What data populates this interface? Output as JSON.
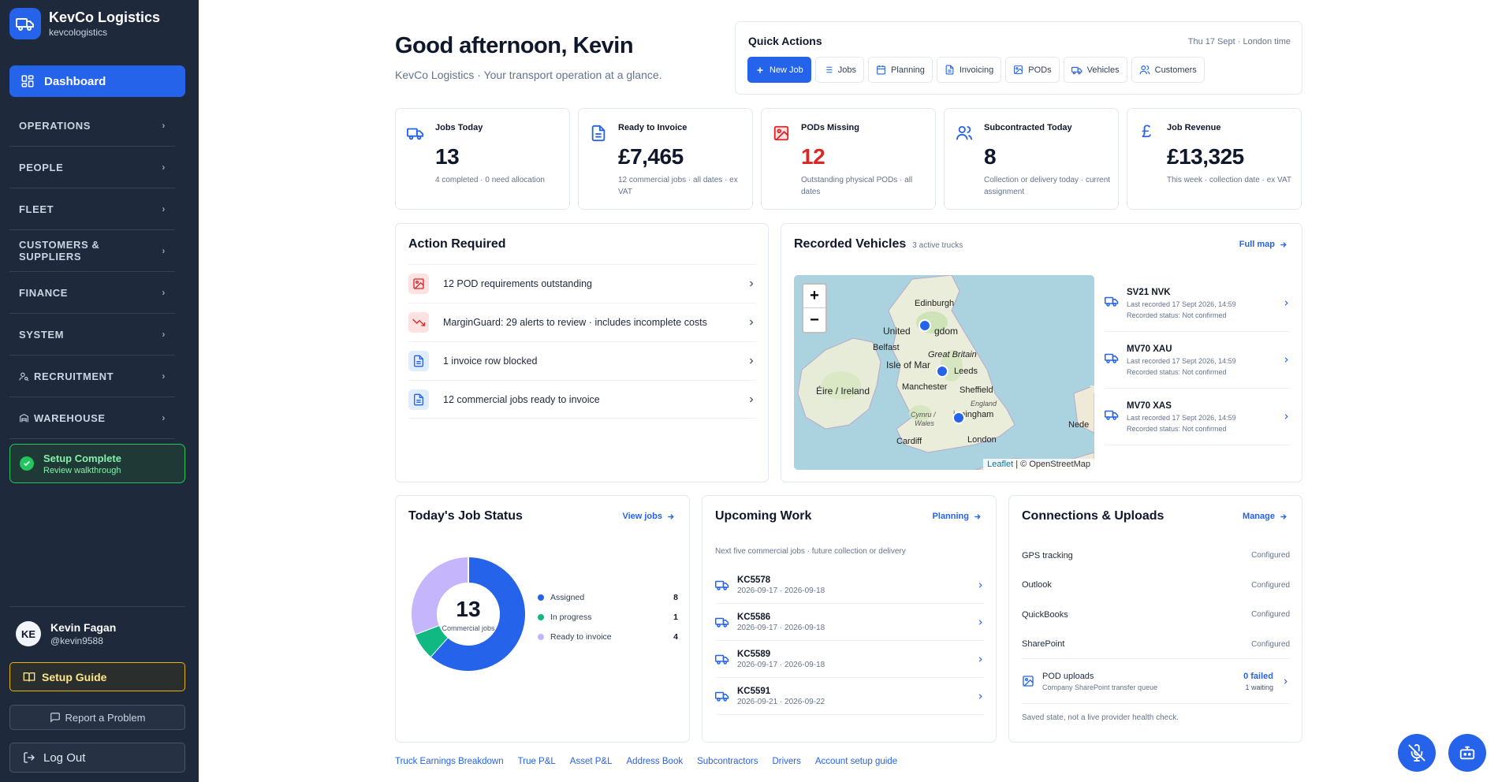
{
  "brand": {
    "name": "KevCo Logistics",
    "sub": "kevcologistics"
  },
  "sidebar": {
    "dashboard": "Dashboard",
    "items": [
      {
        "label": "OPERATIONS",
        "icon": ""
      },
      {
        "label": "PEOPLE",
        "icon": ""
      },
      {
        "label": "FLEET",
        "icon": ""
      },
      {
        "label": "CUSTOMERS & SUPPLIERS",
        "icon": ""
      },
      {
        "label": "FINANCE",
        "icon": ""
      },
      {
        "label": "SYSTEM",
        "icon": ""
      },
      {
        "label": "RECRUITMENT",
        "icon": "user-search-icon"
      },
      {
        "label": "WAREHOUSE",
        "icon": "warehouse-icon"
      }
    ],
    "setup": {
      "title": "Setup Complete",
      "sub": "Review walkthrough"
    }
  },
  "user": {
    "initials": "KE",
    "name": "Kevin Fagan",
    "handle": "@kevin9588"
  },
  "buttons": {
    "guide": "Setup Guide",
    "report": "Report a Problem",
    "logout": "Log Out"
  },
  "header": {
    "greeting": "Good afternoon, Kevin",
    "subtitle": "KevCo Logistics · Your transport operation at a glance."
  },
  "quick_actions": {
    "title": "Quick Actions",
    "date": "Thu 17 Sept · London time",
    "buttons": [
      "New Job",
      "Jobs",
      "Planning",
      "Invoicing",
      "PODs",
      "Vehicles",
      "Customers"
    ]
  },
  "stats": [
    {
      "label": "Jobs Today",
      "value": "13",
      "note": "4 completed · 0 need allocation"
    },
    {
      "label": "Ready to Invoice",
      "value": "£7,465",
      "note": "12 commercial jobs · all dates · ex VAT"
    },
    {
      "label": "PODs Missing",
      "value": "12",
      "note": "Outstanding physical PODs · all dates"
    },
    {
      "label": "Subcontracted Today",
      "value": "8",
      "note": "Collection or delivery today · current assignment"
    },
    {
      "label": "Job Revenue",
      "value": "£13,325",
      "note": "This week · collection date · ex VAT"
    }
  ],
  "action_required": {
    "title": "Action Required",
    "rows": [
      "12 POD requirements outstanding",
      "MarginGuard: 29 alerts to review · includes incomplete costs",
      "1 invoice row blocked",
      "12 commercial jobs ready to invoice"
    ]
  },
  "vehicles": {
    "title": "Recorded Vehicles",
    "count": "3 active trucks",
    "link": "Full map",
    "attribution_leaflet": "Leaflet",
    "attribution_rest": " | © OpenStreetMap",
    "map_labels": {
      "edinburgh": "Edinburgh",
      "united": "United",
      "kingdom": "gdom",
      "belfast": "Belfast",
      "isle": "Isle of Mar",
      "great_britain": "Great Britain",
      "leeds": "Leeds",
      "eire": "Éire / Ireland",
      "manchester": "Manchester",
      "sheffield": "Sheffield",
      "england": "England",
      "cymru": "Cymru /",
      "wales": "Wales",
      "birmingham": "irmingham",
      "cardiff": "Cardiff",
      "london": "London",
      "nede": "Nede"
    },
    "list": [
      {
        "reg": "SV21 NVK",
        "last": "Last recorded 17 Sept 2026, 14:59",
        "status": "Recorded status: Not confirmed"
      },
      {
        "reg": "MV70 XAU",
        "last": "Last recorded 17 Sept 2026, 14:59",
        "status": "Recorded status: Not confirmed"
      },
      {
        "reg": "MV70 XAS",
        "last": "Last recorded 17 Sept 2026, 14:59",
        "status": "Recorded status: Not confirmed"
      }
    ]
  },
  "job_status": {
    "title": "Today's Job Status",
    "link": "View jobs",
    "total": "13",
    "total_label": "Commercial jobs",
    "legend": [
      {
        "label": "Assigned",
        "count": 8,
        "color": "#2563eb"
      },
      {
        "label": "In progress",
        "count": 1,
        "color": "#10b981"
      },
      {
        "label": "Ready to invoice",
        "count": 4,
        "color": "#c4b5fd"
      }
    ]
  },
  "upcoming": {
    "title": "Upcoming Work",
    "link": "Planning",
    "subtitle": "Next five commercial jobs · future collection or delivery",
    "jobs": [
      {
        "id": "KC5578",
        "dates": "2026-09-17 · 2026-09-18"
      },
      {
        "id": "KC5586",
        "dates": "2026-09-17 · 2026-09-18"
      },
      {
        "id": "KC5589",
        "dates": "2026-09-17 · 2026-09-18"
      },
      {
        "id": "KC5591",
        "dates": "2026-09-21 · 2026-09-22"
      }
    ]
  },
  "connections": {
    "title": "Connections & Uploads",
    "link": "Manage",
    "items": [
      {
        "name": "GPS tracking",
        "status": "Configured"
      },
      {
        "name": "Outlook",
        "status": "Configured"
      },
      {
        "name": "QuickBooks",
        "status": "Configured"
      },
      {
        "name": "SharePoint",
        "status": "Configured"
      }
    ],
    "pod": {
      "title": "POD uploads",
      "sub": "Company SharePoint transfer queue",
      "failed": "0 failed",
      "waiting": "1 waiting"
    },
    "note": "Saved state, not a live provider health check."
  },
  "footer_links": [
    "Truck Earnings Breakdown",
    "True P&L",
    "Asset P&L",
    "Address Book",
    "Subcontractors",
    "Drivers",
    "Account setup guide"
  ],
  "colors": {
    "primary": "#2563eb",
    "sidebar": "#1e293b",
    "danger": "#dc2626",
    "success": "#22c55e"
  }
}
